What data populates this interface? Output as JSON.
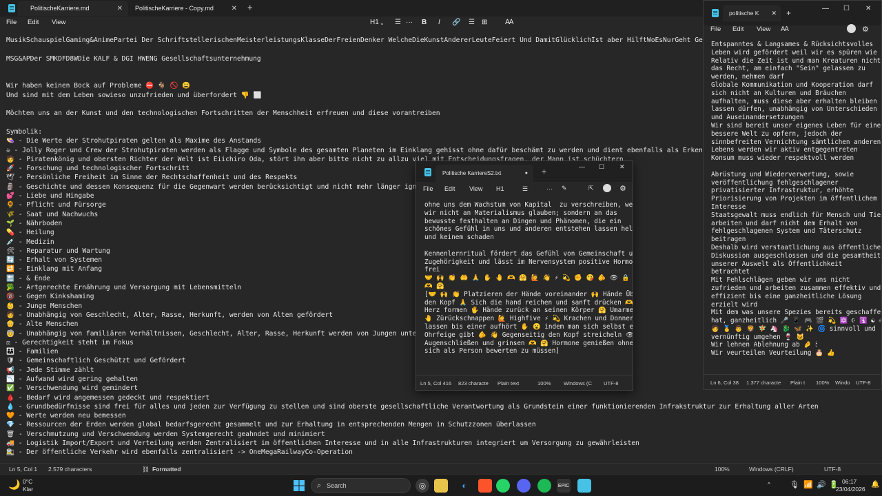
{
  "main_window": {
    "tabs": [
      {
        "label": "PolitischeKarriere.md",
        "close": "✕"
      },
      {
        "label": "PolitischeKarriere - Copy.md",
        "close": "✕"
      }
    ],
    "new_tab": "+",
    "window_controls": {
      "minimize": "—",
      "maximize": "☐",
      "close": "✕"
    },
    "menu": {
      "file": "File",
      "edit": "Edit",
      "view": "View"
    },
    "toolbar": {
      "heading": "H1",
      "bold": "B",
      "italic": "I",
      "list": "☰",
      "more": "···",
      "table": "⊞",
      "clear_format": "Ꜳ"
    },
    "lines": [
      "MusikSchauspielGaming&AnimePartei Der SchriftstellerischenMeisterleistungsKlasseDerFreienDenker WelcheDieKunstAndererLeuteFeiert Und DamitGlücklichIst aber HilftWoEsNurGeht Gesellschaftsunte",
      "",
      "MSG&APDer SMKDFD8WDie KALF & DGI HWENG Gesellschaftsunternehmung",
      "",
      "",
      "Wir haben keinen Bock auf Probleme ⛔ 🐐 🚫 😩",
      "Und sind mit dem Leben sowieso unzufrieden und überfordert 👎 ⬜",
      "",
      "Möchten uns an der Kunst und den technologischen Fortschritten der Menschheit erfreuen und diese vorantreiben",
      "",
      "Symbolik:",
      "👒 - Die Werte der Strohutpiraten gelten als Maxime des Anstands",
      "☠ - Jolly Roger und Crew der Strohutpiraten werden als Flagge und Symbole des gesamten Planeten im Einklang gehisst ohne dafür beschämt zu werden und dient ebenfalls als Erkennungszeichen",
      "🧑 - Piratenkönig und obersten Richter der Welt ist Eiichiro Oda, stört ihn aber bitte nicht zu allzu viel mit Entscheidungsfragen, der Mann ist schüchtern",
      "🚀 - Forschung und technologischer Fortschritt",
      "🕊 - Persönliche Freiheit im Sinne der Rechtschaffenheit und des Respekts",
      "🗿 - Geschichte und dessen Konsequenz für die Gegenwart werden berücksichtigt und nicht mehr länger ignoriert",
      "💕 - Liebe und Hingabe",
      "🌻 - Pflicht und Fürsorge",
      "🌾 - Saat und Nachwuchs",
      "🌱 - Nährboden",
      "💊 - Heilung",
      "💉 - Medizin",
      "🛠 - Reparatur und Wartung",
      "🔄 - Erhalt von Systemen",
      "🔁 - Einklang mit Anfang",
      "🔚 - & Ende",
      "🥦 - Artgerechte Ernährung und Versorgung mit Lebensmitteln",
      "🔞 - Gegen Kinkshaming",
      "👶 - Junge Menschen",
      "🧑 - Unabhängig von Geschlecht, Alter, Rasse, Herkunft, werden von Alten gefördert",
      "👴 - Alte Menschen",
      "🧓 - Unabhängig von familiären Verhältnissen, Geschlecht, Alter, Rasse, Herkunft werden von Jungen unterstützt",
      "⚖ - Gerechtigkeit steht im Fokus",
      "👪 - Familien",
      "🛡 - Gemeinschaftlich Geschützt und Gefördert",
      "📢 - Jede Stimme zählt",
      "📉 - Aufwand wird gering gehalten",
      "✅ - Verschwendung wird gemindert",
      "🩸 - Bedarf wird angemessen gedeckt und respektiert",
      "💧 - Grundbedürfnisse sind frei für alles und jeden zur Verfügung zu stellen und sind oberste gesellschaftliche Verantwortung als Grundstein einer funktionierenden Infrakstruktur zur Erhaltung aller Arten",
      "🧡 - Werte werden neu bemessen",
      "💎 - Ressourcen der Erden werden global bedarfsgerecht gesammelt und zur Erhaltung in entsprechenden Mengen in Schutzzonen überlassen",
      "🗑 - Verschmutzung und Verschwendung werden Systemgerecht geahndet und minimiert",
      "🚚 - Logistik Import/Export und Verteilung werden Zentralisiert im öffentlichen Interesse und in alle Infrastrukturen integriert um Versorgung zu gewährleisten",
      "🚉 - Der öffentliche Verkehr wird ebenfalls zentralisiert -> OneMegaRailwayCo-Operation"
    ],
    "status": {
      "position": "Ln 5, Col 1",
      "chars": "2.579 characters",
      "format": "Formatted",
      "zoom": "100%",
      "line_ending": "Windows (CRLF)",
      "encoding": "UTF-8"
    }
  },
  "right_window": {
    "tab": "politische K",
    "close": "✕",
    "new_tab": "+",
    "window_controls": {
      "minimize": "—",
      "maximize": "☐",
      "close": "✕"
    },
    "menu": {
      "file": "File",
      "edit": "Edit",
      "view": "View",
      "format": "Ꜳ"
    },
    "lines": [
      "Entspanntes & Langsames & Rücksichtsvolles",
      "Leben wird gefördert weil wir es spüren wie",
      "Relativ die Zeit ist und man Kreaturen nicht",
      "das Recht, am einfach \"Sein\" gelassen zu",
      "werden, nehmen darf",
      "Globale Kommunikation und Kooperation darf",
      "sich nicht an Kulturen und Bräuchen",
      "aufhalten, muss diese aber erhalten bleiben",
      "lassen dürfen, unabhängig von Unterschieden",
      "und Auseinandersetzungen",
      "Wir sind bereit unser eigenes Leben für eine",
      "bessere Welt zu opfern, jedoch der",
      "sinnbefreiten Vernichtung sämtlichen anderen",
      "Lebens werden wir aktiv entgegentreten",
      "Konsum muss wieder respektvoll werden",
      "",
      "Abrüstung und Wiederverwertung, sowie",
      "veröffentlichung fehlgeschlagener",
      "privatisierter Infrastruktur, erhöhte",
      "Priorisierung von Projekten im öffentlichem",
      "Interesse",
      "Staatsgewalt muss endlich für Mensch und Tier",
      "arbeiten und darf nicht dem Erhalt von",
      "fehlgeschlagenen System und Täterschutz",
      "beitragen",
      "Deshalb wird verstaatlichung aus öffentlicher",
      "Diskussion ausgeschlossen und die gesamtheit",
      "unserer Auswelt als Öffentlichkeit",
      "betrachtet",
      "Mit Fehlschlägen geben wir uns nicht",
      "zufrieden und arbeiten zusammen effektiv und",
      "effizient bis eine ganzheitliche Lösung",
      "erzielt wird",
      "Mit dem was unsere Spezies bereits geschaffen",
      "hat, ganzheitlich 🎤 📱 🎮 🎬 💫 🔯 ☪ 🛐 ☯ ♾ 🔷",
      "🧑 🥇 👨 🦁 🧚 🦄 🐉 🦋 ✨ 🌀 sinnvoll und",
      "vernünftig umgehen 🍷 🐱",
      "Wir lehnen Ablehnung ab 🤌 🕯",
      "Wir veurteilen Veurteilung 🎂 👍"
    ],
    "status": {
      "position": "Ln 6, Col 38",
      "chars": "1.377 characte",
      "format": "Plain t",
      "zoom": "100%",
      "line_ending": "Windo",
      "encoding": "UTF-8"
    }
  },
  "mid_window": {
    "tab": "Politische KarriereS2.txt",
    "unsaved_dot": "●",
    "new_tab": "+",
    "window_controls": {
      "minimize": "—",
      "maximize": "☐",
      "close": "✕"
    },
    "menu": {
      "file": "File",
      "edit": "Edit",
      "view": "View",
      "heading": "H1",
      "list": "☰",
      "more": "···"
    },
    "lines": [
      "ohne uns dem Wachstum von Kapital  zu verschreiben, weil",
      "wir nicht an Materialismus glauben; sondern an das",
      "bewusste festhalten an Dingen und Phänomen, die ein",
      "schönes Gefühl in uns und anderen entstehen lassen helfen",
      "und keinem schaden",
      "",
      "Kennenlernritual fördert das Gefühl von Gemeinschaft und",
      "Zugehörigkeit und lässt im Nervensystem positive Hormone",
      "frei",
      "🤝 🙌 👏 🤲 🙏 ✋ 🤚 🫶 🤗 🙋 👋 ⚡ 💫 ✊ 😘 🫵 👁 🔒 😊",
      "🫶 🤗",
      "[🤝 🙌 👏 Platzieren der Hände voreinander 🙌 Hände Über",
      "den Kopf 🙏 Sich die hand reichen und sanft drücken 🫶",
      "Herz formen 🖐 Hände zurück an seinen Körper 🤗 Umarmen 🙋",
      "🤚 Zürückschnappen 🙋 Highfive ⚡ 💫 Krachen und Donnern",
      "lassen bis einer aufhört ✋ 😮 indem man sich selbst eine",
      "Ohrfeige gibt 🫵 👋 Gegenseitig den Kopf streicheln 👁 🔒 😊",
      "Augenschließen und grinsen 🫶 🤗 Hormone genießen ohne",
      "sich als Person bewerten zu müssen]"
    ],
    "status": {
      "position": "Ln 5, Col 416",
      "chars": "823 characte",
      "format": "Plain text",
      "zoom": "100%",
      "line_ending": "Windows (C",
      "encoding": "UTF-8"
    }
  },
  "taskbar": {
    "weather": {
      "temp": "0°C",
      "condition": "Klar",
      "icon": "🌙"
    },
    "search_placeholder": "Search",
    "tray": {
      "chevron": "^",
      "time": "06:17",
      "date": "23/04/2026"
    }
  }
}
